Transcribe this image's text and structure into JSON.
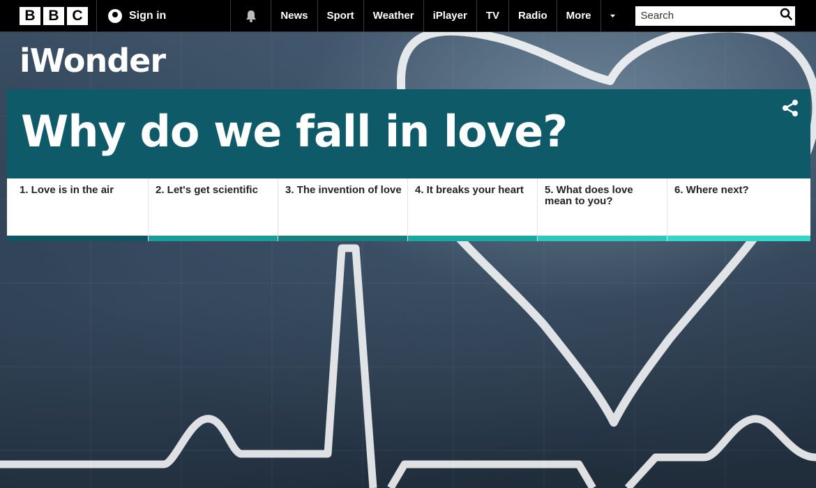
{
  "header": {
    "logo_letters": [
      "B",
      "B",
      "C"
    ],
    "sign_in": "Sign in",
    "nav": [
      "News",
      "Sport",
      "Weather",
      "iPlayer",
      "TV",
      "Radio",
      "More"
    ],
    "search_placeholder": "Search"
  },
  "brand": {
    "name": "iWonder"
  },
  "page": {
    "title": "Why do we fall in love?"
  },
  "chapters": [
    {
      "label": "1. Love is in the air",
      "color": "#0f5665"
    },
    {
      "label": "2. Let's get scientific",
      "color": "#1a9c9a"
    },
    {
      "label": "3. The invention of love",
      "color": "#15807e"
    },
    {
      "label": "4. It breaks your heart",
      "color": "#1aa8a3"
    },
    {
      "label": "5. What does love mean to you?",
      "color": "#2cc7bd"
    },
    {
      "label": "6. Where next?",
      "color": "#33d6c9"
    }
  ],
  "colors": {
    "title_panel": "#0e5a68",
    "topbar": "#000000"
  }
}
